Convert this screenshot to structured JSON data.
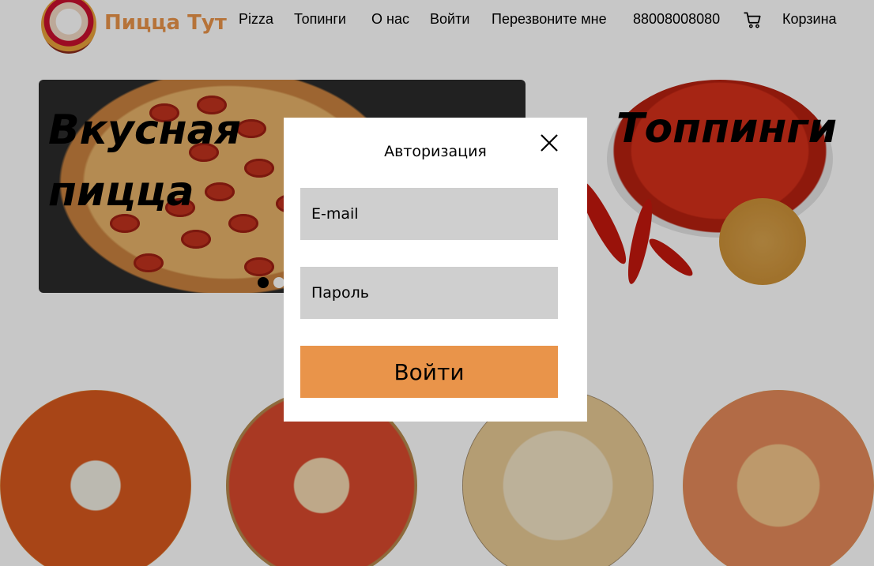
{
  "header": {
    "brand": "Пицца Тут",
    "nav": [
      "Pizza",
      "Топинги",
      "О нас",
      "Войти",
      "Перезвоните мне",
      "88008008080"
    ],
    "cart_label": "Корзина"
  },
  "slider": {
    "slide1_title_line1": "Вкусная",
    "slide1_title_line2": "пицца",
    "slide2_title": "Топпинги",
    "active_slide_index": 0
  },
  "modal": {
    "title": "Авторизация",
    "email_placeholder": "E-mail",
    "password_placeholder": "Пароль",
    "submit_label": "Войти"
  },
  "colors": {
    "accent": "#e9944a",
    "field_bg": "#cfcfcf",
    "overlay": "rgba(0,0,0,0.22)"
  },
  "icons": {
    "cart": "cart-icon",
    "close": "close-icon",
    "logo": "chef-logo"
  }
}
